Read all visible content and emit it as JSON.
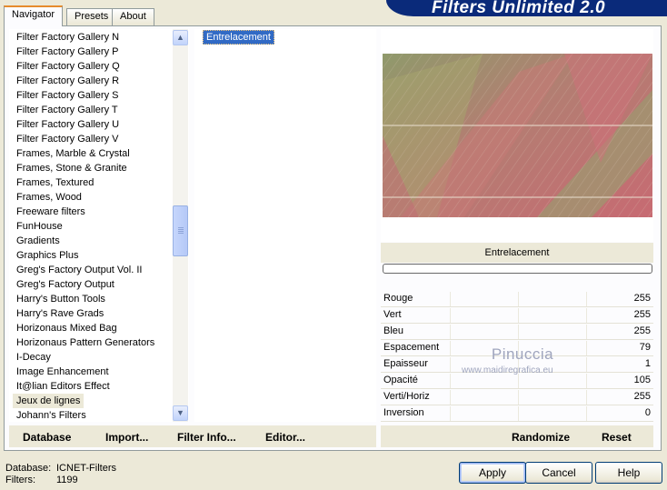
{
  "tabs": [
    {
      "label": "Navigator",
      "active": true
    },
    {
      "label": "Presets",
      "active": false
    },
    {
      "label": "About",
      "active": false
    }
  ],
  "banner_title": "Filters Unlimited 2.0",
  "categories": [
    "Filter Factory Gallery N",
    "Filter Factory Gallery P",
    "Filter Factory Gallery Q",
    "Filter Factory Gallery R",
    "Filter Factory Gallery S",
    "Filter Factory Gallery T",
    "Filter Factory Gallery U",
    "Filter Factory Gallery V",
    "Frames, Marble & Crystal",
    "Frames, Stone & Granite",
    "Frames, Textured",
    "Frames, Wood",
    "Freeware filters",
    "FunHouse",
    "Gradients",
    "Graphics Plus",
    "Greg's Factory Output Vol. II",
    "Greg's Factory Output",
    "Harry's Button Tools",
    "Harry's Rave Grads",
    "Horizonaus Mixed Bag",
    "Horizonaus Pattern Generators",
    "I-Decay",
    "Image Enhancement",
    "It@lian Editors Effect",
    "Jeux de lignes",
    "Johann's Filters"
  ],
  "selected_category": "Jeux de lignes",
  "filters": [
    "Entrelacement"
  ],
  "selected_filter": "Entrelacement",
  "preview_filter_name": "Entrelacement",
  "progress": 0,
  "params": [
    {
      "label": "Rouge",
      "value": "255"
    },
    {
      "label": "Vert",
      "value": "255"
    },
    {
      "label": "Bleu",
      "value": "255"
    },
    {
      "label": "Espacement",
      "value": "79"
    },
    {
      "label": "Epaisseur",
      "value": "1"
    },
    {
      "label": "Opacité",
      "value": "105"
    },
    {
      "label": "Verti/Horiz",
      "value": "255"
    },
    {
      "label": "Inversion",
      "value": "0"
    }
  ],
  "watermark": {
    "name": "Pinuccia",
    "site": "www.maidiregrafica.eu"
  },
  "toolbar": {
    "database": "Database",
    "import": "Import...",
    "filter_info": "Filter Info...",
    "editor": "Editor...",
    "randomize": "Randomize",
    "reset": "Reset"
  },
  "status": {
    "database_label": "Database:",
    "database_value": "ICNET-Filters",
    "filters_label": "Filters:",
    "filters_value": "1199"
  },
  "buttons": {
    "apply": "Apply",
    "cancel": "Cancel",
    "help": "Help"
  },
  "icons": {
    "scroll_up": "chevron-up-icon",
    "scroll_down": "chevron-down-icon"
  },
  "colors": {
    "selection": "#316ac5",
    "banner": "#0a2a7a",
    "tab_highlight": "#e68b2c"
  }
}
